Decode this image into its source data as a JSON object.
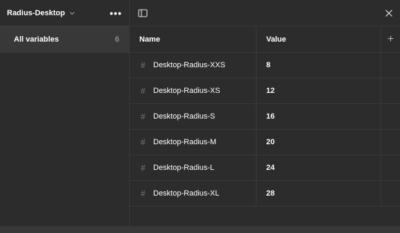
{
  "sidebar": {
    "collection_name": "Radius-Desktop",
    "more_label": "•••",
    "groups": [
      {
        "label": "All variables",
        "count": "6"
      }
    ]
  },
  "topbar": {
    "panel_icon": "sidebar-panel-icon",
    "close_icon": "close-icon"
  },
  "table": {
    "headers": {
      "name": "Name",
      "value": "Value",
      "add": "+"
    },
    "type_symbol": "#",
    "rows": [
      {
        "name": "Desktop-Radius-XXS",
        "value": "8"
      },
      {
        "name": "Desktop-Radius-XS",
        "value": "12"
      },
      {
        "name": "Desktop-Radius-S",
        "value": "16"
      },
      {
        "name": "Desktop-Radius-M",
        "value": "20"
      },
      {
        "name": "Desktop-Radius-L",
        "value": "24"
      },
      {
        "name": "Desktop-Radius-XL",
        "value": "28"
      }
    ]
  },
  "colors": {
    "background": "#2c2c2c",
    "selected": "#383838",
    "border": "#3a3a3a",
    "text": "#ffffff",
    "muted": "#b3b3b3"
  }
}
